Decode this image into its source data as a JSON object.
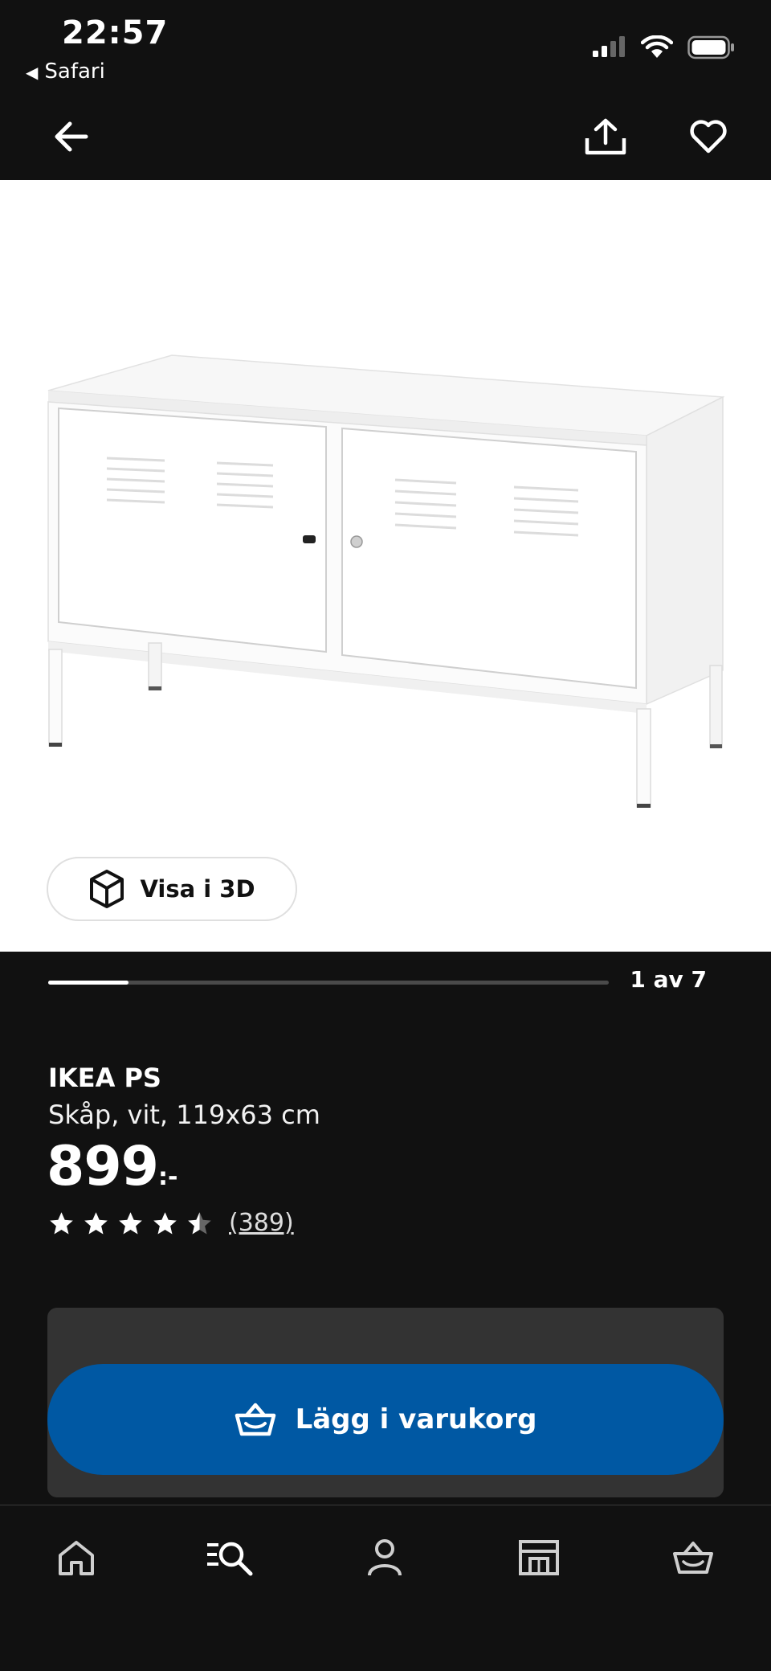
{
  "status_bar": {
    "time": "22:57",
    "back_app": "Safari",
    "back_glyph": "◀"
  },
  "product": {
    "visa_3d_label": "Visa i 3D",
    "gallery_counter": "1 av 7",
    "gallery_position": 1,
    "gallery_total": 7,
    "brand": "IKEA PS",
    "description": "Skåp, vit, 119x63 cm",
    "price_integer": "899",
    "price_decimals": ":-",
    "rating": 4.5,
    "rating_max": 5,
    "review_count": "(389)"
  },
  "cart": {
    "add_label": "Lägg i varukorg"
  },
  "nav": {
    "tabs": [
      "home-icon",
      "search-icon",
      "profile-icon",
      "store-icon",
      "cart-icon"
    ]
  },
  "colors": {
    "background": "#111111",
    "accent_blue": "#0058a3",
    "panel": "#333333",
    "image_bg": "#ffffff"
  }
}
